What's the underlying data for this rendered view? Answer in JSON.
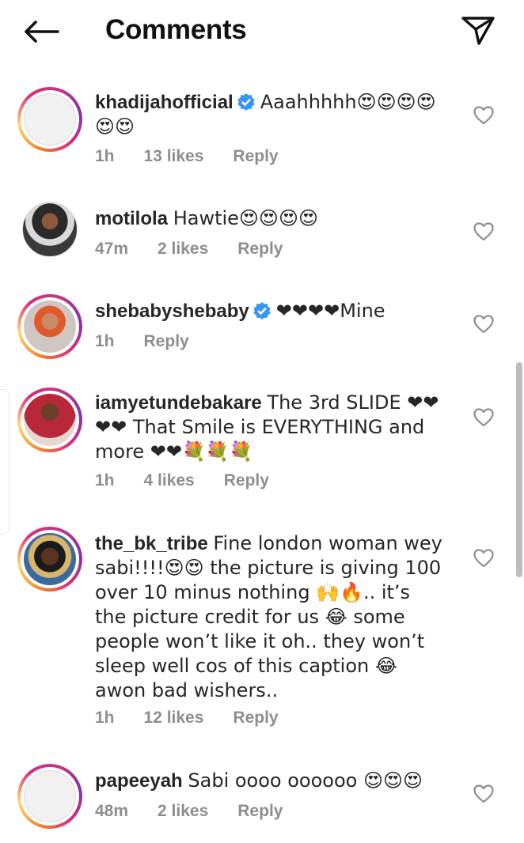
{
  "header": {
    "title": "Comments",
    "back_icon": "arrow-left-icon",
    "share_icon": "paper-plane-icon"
  },
  "comments": [
    {
      "username": "khadijahofficial",
      "verified": true,
      "text": "Aaahhhhh😍😍😍😍😍😍",
      "time": "1h",
      "likes": "13 likes",
      "reply": "Reply",
      "avatar": "story-ring-placeholder"
    },
    {
      "username": "motilola",
      "verified": false,
      "text": "Hawtie😍😍😍😍",
      "time": "47m",
      "likes": "2 likes",
      "reply": "Reply",
      "avatar": "woman-dark-photo"
    },
    {
      "username": "shebabyshebaby",
      "verified": true,
      "text": "❤❤❤❤Mine",
      "time": "1h",
      "likes": "",
      "reply": "Reply",
      "avatar": "woman-orange-hair-photo"
    },
    {
      "username": "iamyetundebakare",
      "verified": false,
      "text": "The 3rd SLIDE ❤❤❤❤ That Smile is EVERYTHING and more ❤❤💐💐💐",
      "time": "1h",
      "likes": "4 likes",
      "reply": "Reply",
      "avatar": "woman-red-dress-photo"
    },
    {
      "username": "the_bk_tribe",
      "verified": false,
      "text": "Fine london woman wey sabi!!!!😍😍 the picture is giving 100 over 10 minus nothing 🙌🔥.. it’s the picture credit for us 😂 some people won’t like it oh.. they won’t sleep well cos of this caption 😂 awon bad wishers..",
      "time": "1h",
      "likes": "12 likes",
      "reply": "Reply",
      "avatar": "woman-headwrap-photo"
    },
    {
      "username": "papeeyah",
      "verified": false,
      "text": "Sabi oooo oooooo 😍😍😍",
      "time": "48m",
      "likes": "2 likes",
      "reply": "Reply",
      "avatar": "story-ring-placeholder"
    }
  ],
  "colors": {
    "text": "#262626",
    "meta": "#8e8e8e",
    "verified": "#3897f0",
    "heart_emoji": "#e8202a"
  }
}
